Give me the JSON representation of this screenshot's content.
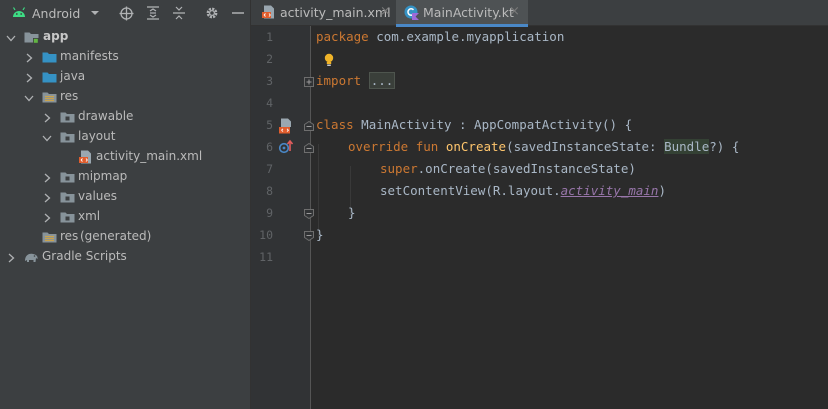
{
  "project_panel": {
    "view_selector": "Android",
    "tree": [
      {
        "label": "app",
        "level": 0,
        "expanded": true,
        "icon": "module-folder-icon"
      },
      {
        "label": "manifests",
        "level": 1,
        "expanded": false,
        "icon": "folder-icon"
      },
      {
        "label": "java",
        "level": 1,
        "expanded": false,
        "icon": "folder-icon"
      },
      {
        "label": "res",
        "level": 1,
        "expanded": true,
        "icon": "resource-folder-icon"
      },
      {
        "label": "drawable",
        "level": 2,
        "expanded": false,
        "icon": "package-folder-icon"
      },
      {
        "label": "layout",
        "level": 2,
        "expanded": true,
        "icon": "package-folder-icon"
      },
      {
        "label": "activity_main.xml",
        "level": 3,
        "icon": "xml-layout-file-icon"
      },
      {
        "label": "mipmap",
        "level": 2,
        "expanded": false,
        "icon": "package-folder-icon"
      },
      {
        "label": "values",
        "level": 2,
        "expanded": false,
        "icon": "package-folder-icon"
      },
      {
        "label": "xml",
        "level": 2,
        "expanded": false,
        "icon": "package-folder-icon"
      },
      {
        "label": "res",
        "suffix": "(generated)",
        "level": 1,
        "icon": "resource-folder-icon"
      },
      {
        "label": "Gradle Scripts",
        "level": 0,
        "expanded": false,
        "icon": "gradle-elephant-icon"
      }
    ]
  },
  "editor": {
    "tabs": [
      {
        "label": "activity_main.xml",
        "icon": "xml-layout-file-icon",
        "active": false
      },
      {
        "label": "MainActivity.kt",
        "icon": "kotlin-class-icon",
        "active": true
      }
    ],
    "close_glyph": "×",
    "line_numbers": [
      "1",
      "2",
      "3",
      "4",
      "5",
      "6",
      "7",
      "8",
      "9",
      "10",
      "11"
    ],
    "code": {
      "l1_kw": "package",
      "l1_rest": " com.example.myapplication",
      "l3_kw": "import",
      "l3_folded": "...",
      "l6_kw": "class",
      "l6_a": " MainActivity : AppCompatActivity() {",
      "l7_kw": "override fun",
      "l7_fn": "onCreate",
      "l7_a": "(savedInstanceState: ",
      "l7_type": "Bundle",
      "l7_b": "?) {",
      "l8_kw": "super",
      "l8_a": ".onCreate(savedInstanceState)",
      "l9_a": "setContentView(R.layout.",
      "l9_res": "activity_main",
      "l9_b": ")",
      "l10": "}",
      "l11": "}"
    }
  },
  "colors": {
    "accent": "#4a88c7",
    "keyword": "#cc7832",
    "function": "#ffc66d",
    "plain": "#a9b7c6",
    "resource": "#9876aa",
    "android_green": "#3ddc84"
  }
}
